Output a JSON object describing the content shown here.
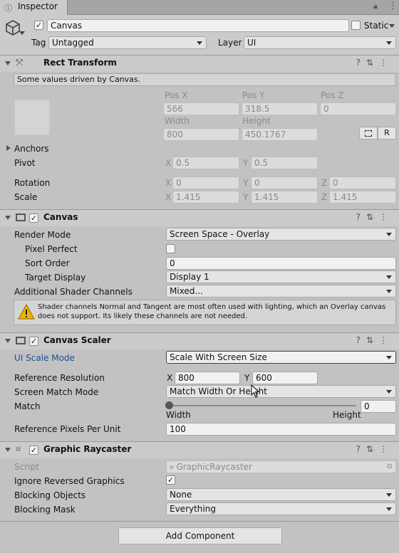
{
  "tab": {
    "title": "Inspector"
  },
  "object": {
    "name": "Canvas",
    "static_label": "Static",
    "tag_label": "Tag",
    "tag_value": "Untagged",
    "layer_label": "Layer",
    "layer_value": "UI"
  },
  "rect_transform": {
    "title": "Rect Transform",
    "note": "Some values driven by Canvas.",
    "pos_x_label": "Pos X",
    "pos_y_label": "Pos Y",
    "pos_z_label": "Pos Z",
    "pos_x": "566",
    "pos_y": "318.5",
    "pos_z": "0",
    "width_label": "Width",
    "height_label": "Height",
    "width": "800",
    "height": "450.1767",
    "r_button": "R",
    "anchors_label": "Anchors",
    "pivot_label": "Pivot",
    "pivot_x": "0.5",
    "pivot_y": "0.5",
    "rotation_label": "Rotation",
    "rot_x": "0",
    "rot_y": "0",
    "rot_z": "0",
    "scale_label": "Scale",
    "scale_x": "1.415",
    "scale_y": "1.415",
    "scale_z": "1.415",
    "x": "X",
    "y": "Y",
    "z": "Z"
  },
  "canvas": {
    "title": "Canvas",
    "render_mode_label": "Render Mode",
    "render_mode": "Screen Space - Overlay",
    "pixel_perfect_label": "Pixel Perfect",
    "sort_order_label": "Sort Order",
    "sort_order": "0",
    "target_display_label": "Target Display",
    "target_display": "Display 1",
    "shader_channels_label": "Additional Shader Channels",
    "shader_channels": "Mixed...",
    "warning": "Shader channels Normal and Tangent are most often used with lighting, which an Overlay canvas does not support. Its likely these channels are not needed."
  },
  "scaler": {
    "title": "Canvas Scaler",
    "ui_scale_mode_label": "UI Scale Mode",
    "ui_scale_mode": "Scale With Screen Size",
    "ref_res_label": "Reference Resolution",
    "ref_x": "800",
    "ref_y": "600",
    "match_mode_label": "Screen Match Mode",
    "match_mode": "Match Width Or Height",
    "match_label": "Match",
    "match_value": "0",
    "width_label": "Width",
    "height_label": "Height",
    "ppu_label": "Reference Pixels Per Unit",
    "ppu": "100"
  },
  "raycaster": {
    "title": "Graphic Raycaster",
    "script_label": "Script",
    "script": "GraphicRaycaster",
    "ignore_reversed_label": "Ignore Reversed Graphics",
    "blocking_objects_label": "Blocking Objects",
    "blocking_objects": "None",
    "blocking_mask_label": "Blocking Mask",
    "blocking_mask": "Everything"
  },
  "add_component": "Add Component"
}
